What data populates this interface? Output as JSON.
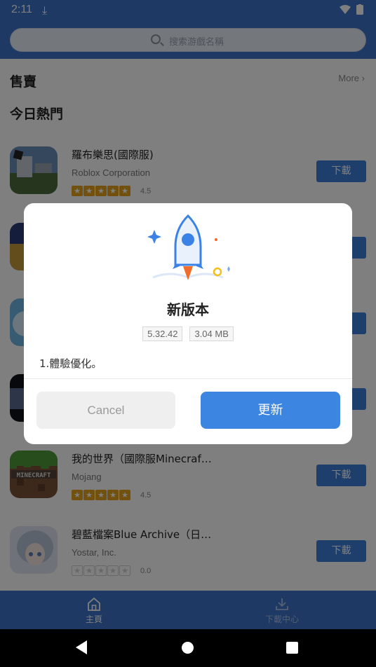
{
  "status_bar": {
    "time": "2:11"
  },
  "search": {
    "placeholder": "搜索游戲名稱"
  },
  "section": {
    "title": "售賣",
    "more_label": "More",
    "subtitle": "今日熱門"
  },
  "apps": [
    {
      "name": "羅布樂思(國際服)",
      "developer": "Roblox Corporation",
      "rating": "4.5",
      "stars": 5,
      "button": "下載"
    },
    {
      "name": "",
      "developer": "",
      "rating": "",
      "stars": 0,
      "button": "下載"
    },
    {
      "name": "",
      "developer": "",
      "rating": "",
      "stars": 0,
      "button": "下載"
    },
    {
      "name": "",
      "developer": "",
      "rating": "",
      "stars": 0,
      "button": "下載"
    },
    {
      "name": "我的世界（國際服Minecraf…",
      "developer": "Mojang",
      "rating": "4.5",
      "stars": 5,
      "button": "下載"
    },
    {
      "name": "碧藍檔案Blue Archive（日…",
      "developer": "Yostar, Inc.",
      "rating": "0.0",
      "stars": 0,
      "button": "下載"
    }
  ],
  "bottom_nav": [
    {
      "label": "主頁",
      "icon": "home-icon"
    },
    {
      "label": "下載中心",
      "icon": "download-icon"
    }
  ],
  "dialog": {
    "title": "新版本",
    "version": "5.32.42",
    "size": "3.04 MB",
    "notes": "1.體驗優化。",
    "cancel_label": "Cancel",
    "update_label": "更新"
  },
  "colors": {
    "primary": "#3c72c7",
    "button": "#3c7fd8",
    "star": "#e3a21a"
  }
}
